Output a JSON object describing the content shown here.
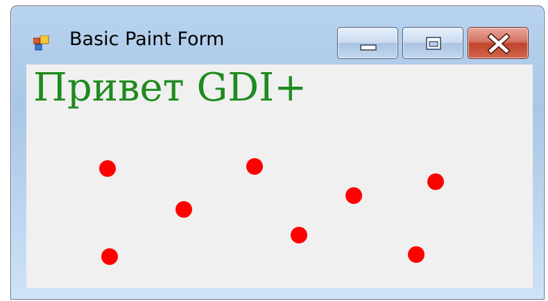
{
  "window": {
    "title": "Basic Paint Form",
    "icon": "app-form-icon",
    "controls": {
      "minimize": "minimize-icon",
      "maximize": "restore-icon",
      "close": "close-icon"
    }
  },
  "canvas": {
    "text": "Привет GDI+",
    "text_color": "#1f8a1f",
    "background": "#f0f0f0",
    "dot_color": "#ff0000"
  }
}
